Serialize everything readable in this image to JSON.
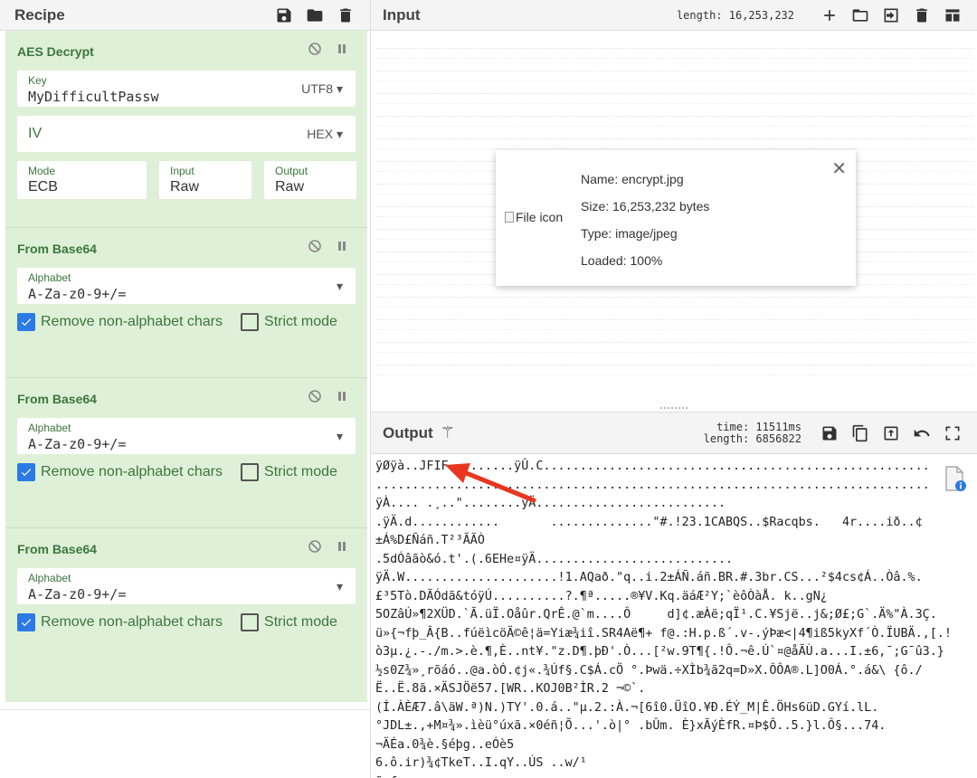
{
  "recipe": {
    "title": "Recipe",
    "icons": [
      "save-icon",
      "folder-icon",
      "trash-icon"
    ],
    "operations": [
      {
        "title": "AES Decrypt",
        "key": {
          "label": "Key",
          "value": "MyDifficultPassw",
          "encoding": "UTF8"
        },
        "iv": {
          "label": "IV",
          "encoding": "HEX"
        },
        "mode": {
          "label": "Mode",
          "value": "ECB"
        },
        "input": {
          "label": "Input",
          "value": "Raw"
        },
        "output": {
          "label": "Output",
          "value": "Raw"
        }
      },
      {
        "title": "From Base64",
        "alphabet_label": "Alphabet",
        "alphabet": "A-Za-z0-9+/=",
        "remove_label": "Remove non-alphabet chars",
        "strict_label": "Strict mode"
      },
      {
        "title": "From Base64",
        "alphabet_label": "Alphabet",
        "alphabet": "A-Za-z0-9+/=",
        "remove_label": "Remove non-alphabet chars",
        "strict_label": "Strict mode"
      },
      {
        "title": "From Base64",
        "alphabet_label": "Alphabet",
        "alphabet": "A-Za-z0-9+/=",
        "remove_label": "Remove non-alphabet chars",
        "strict_label": "Strict mode"
      }
    ]
  },
  "input": {
    "title": "Input",
    "length_text": "length: 16,253,232",
    "file": {
      "icon_alt": "File icon",
      "name": "Name: encrypt.jpg",
      "size": "Size: 16,253,232 bytes",
      "type": "Type: image/jpeg",
      "loaded": "Loaded: 100%"
    }
  },
  "output": {
    "title": "Output",
    "time_text": "time: 11511ms",
    "length_text": "length: 6856822",
    "lines": [
      "ÿØÿà..JFIF.........ÿÛ.C.....................................................",
      "............................................................................",
      "ÿÀ.... .¸..\"........ÿÄ..........................",
      ".ÿÄ.d............       ..............\"#.!23.1CABQS..$Racqbs.   4r....ið..¢",
      "±Á%D£Ñáñ.T²³ÃÃÒ",
      ".5dÓâãò&ó.t'.(.6EHe¤ÿÄ...........................",
      "ÿÄ.W.....................!1.AQað.\"q..i.2±ÁÑ.áñ.BR.#.3br.CS...²$4cs¢Á..Òâ.%.",
      "£³5Tò.DÃÓdã&tóÿÚ..........?.¶ª.....®¥V.Kq.äáÆ²Y;`èôÒàÅ. k..gN¿",
      "5OZâÚ»¶2XÜD.`Ã.üÏ.Oåûr.QrÊ.@`m....Ô     d]¢.æÀë;qÏ¹.C.¥Sjë..j&;Ø£;G`.Ä%\"À.3Ç.",
      "ü»{¬fþ_Â{B..fúëìcöÄ©ê¦ä=Yiæ¾iî.SR4Aë¶+ f@.:H.p.ß´.v-.ýÞæ<|4¶iß5kyXf´Ò.ÏUBÄ.,[.!",
      "ò3µ.¿.-./m.>.è.¶,È..nt¥.\"z.D¶.þÐ'.Ò...[²w.9T¶{.!Ô.¬ê.Ú`¤@åÃÙ.a...I.±6,¯;G¯û3.}",
      "½s0Z¾»¸rõáó..@a.òÓ.¢j«.¾Úf§.C$Á.cÖ °.Þwä.÷XÌb¾ã2q=D»X.ÔÔA®.L]O0Á.°.á&\\ {ô./",
      "Ë..Ë.8ã.×ÄSJÖë57.[WR..KOJ0B²ÌR.2 ¬©`.",
      "(Í.ÀÈÆ7.â\\äW.ª)N.)TY'.0.á..\"µ.2.:À.¬[6î0.ÜîO.¥Ð.ÉÝ_M|Ê.ÖHs6üD.GYí.lL.",
      "°JDL±.,+M¤¾».ìèü°úxã.×0éñ¦Õ...'.ò|° .bÛm. È}xÃýÈfR.¤Þ$Ô..5.}l.Ô§...74.",
      "¬ÄÉa.0¾è.§éþg..eÓè5",
      "6.ô.ir)¾¢TkeT..I.qY..ÚS ..w/¹",
      "ã«f"
    ]
  }
}
